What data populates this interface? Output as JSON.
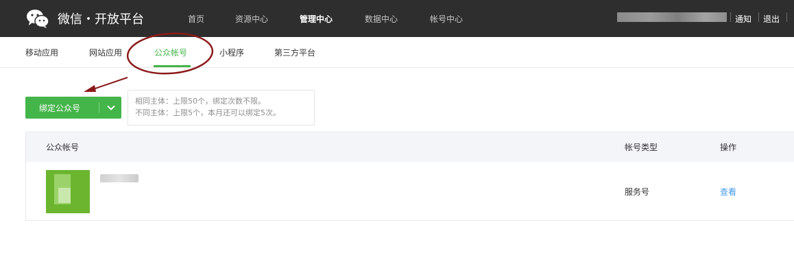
{
  "header": {
    "logo_text": "微信・开放平台",
    "nav": [
      {
        "label": "首页",
        "active": false
      },
      {
        "label": "资源中心",
        "active": false
      },
      {
        "label": "管理中心",
        "active": true
      },
      {
        "label": "数据中心",
        "active": false
      },
      {
        "label": "帐号中心",
        "active": false
      }
    ],
    "notify_label": "通知",
    "logout_label": "退出",
    "icon": "wechat-icon"
  },
  "subnav": {
    "tabs": [
      {
        "label": "移动应用",
        "active": false
      },
      {
        "label": "网站应用",
        "active": false
      },
      {
        "label": "公众帐号",
        "active": true
      },
      {
        "label": "小程序",
        "active": false
      },
      {
        "label": "第三方平台",
        "active": false
      }
    ]
  },
  "bind": {
    "button_label": "绑定公众号",
    "dropdown_icon": "chevron-down-icon",
    "tip_line1": "相同主体：上限50个，绑定次数不限。",
    "tip_line2": "不同主体：上限5个，本月还可以绑定5次。"
  },
  "table": {
    "columns": [
      "公众帐号",
      "帐号类型",
      "操作"
    ],
    "rows": [
      {
        "type": "服务号",
        "action": "查看"
      }
    ]
  },
  "colors": {
    "topbar": "#2e2e2e",
    "accent": "#44b549",
    "link": "#459ae9",
    "annotation": "#8b1a1a"
  }
}
